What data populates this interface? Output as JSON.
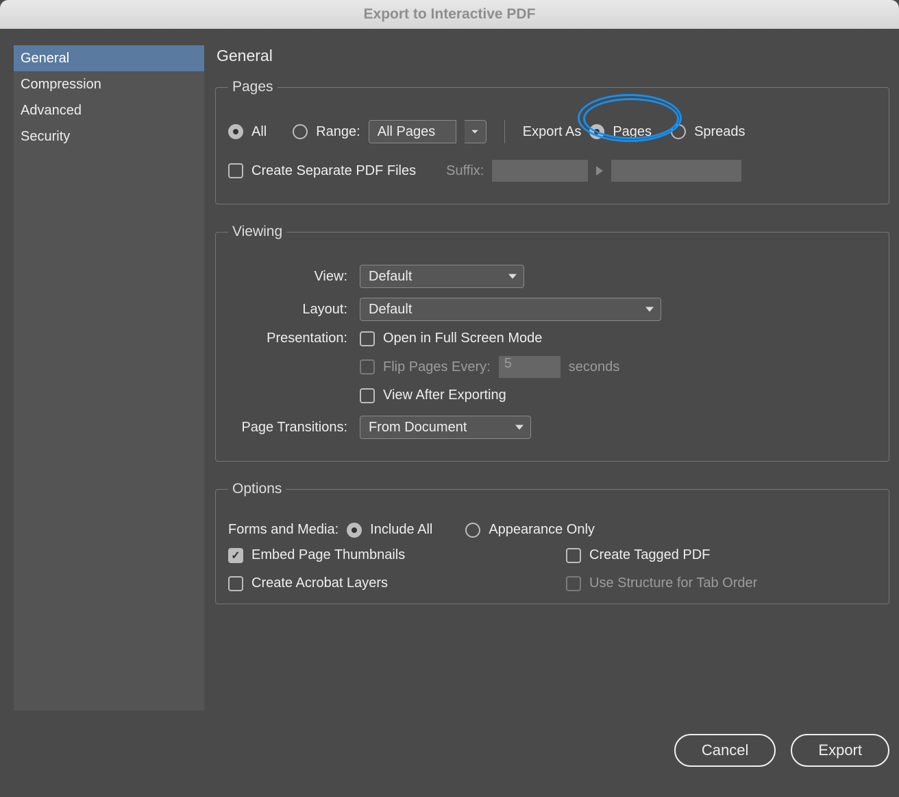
{
  "title": "Export to Interactive PDF",
  "sidebar": {
    "items": [
      {
        "label": "General",
        "active": true
      },
      {
        "label": "Compression",
        "active": false
      },
      {
        "label": "Advanced",
        "active": false
      },
      {
        "label": "Security",
        "active": false
      }
    ]
  },
  "panel": {
    "heading": "General",
    "pages": {
      "legend": "Pages",
      "all_label": "All",
      "all_selected": true,
      "range_label": "Range:",
      "range_selected": false,
      "range_value": "All Pages",
      "export_as_label": "Export As",
      "pages_label": "Pages",
      "pages_selected": true,
      "spreads_label": "Spreads",
      "spreads_selected": false,
      "sep_files_label": "Create Separate PDF Files",
      "sep_files_checked": false,
      "suffix_label": "Suffix:",
      "suffix_value": ""
    },
    "viewing": {
      "legend": "Viewing",
      "view_label": "View:",
      "view_value": "Default",
      "layout_label": "Layout:",
      "layout_value": "Default",
      "presentation_label": "Presentation:",
      "fullscreen_label": "Open in Full Screen Mode",
      "fullscreen_checked": false,
      "flip_label": "Flip Pages Every:",
      "flip_checked": false,
      "flip_value": "5",
      "flip_unit": "seconds",
      "view_after_label": "View After Exporting",
      "view_after_checked": false,
      "transitions_label": "Page Transitions:",
      "transitions_value": "From Document"
    },
    "options": {
      "legend": "Options",
      "forms_label": "Forms and Media:",
      "include_all_label": "Include All",
      "include_all_selected": true,
      "appearance_label": "Appearance Only",
      "appearance_selected": false,
      "embed_thumbs_label": "Embed Page Thumbnails",
      "embed_thumbs_checked": true,
      "tagged_pdf_label": "Create Tagged PDF",
      "tagged_pdf_checked": false,
      "acrobat_layers_label": "Create Acrobat Layers",
      "acrobat_layers_checked": false,
      "structure_tab_label": "Use Structure for Tab Order",
      "structure_tab_checked": false
    }
  },
  "buttons": {
    "cancel": "Cancel",
    "export": "Export"
  }
}
